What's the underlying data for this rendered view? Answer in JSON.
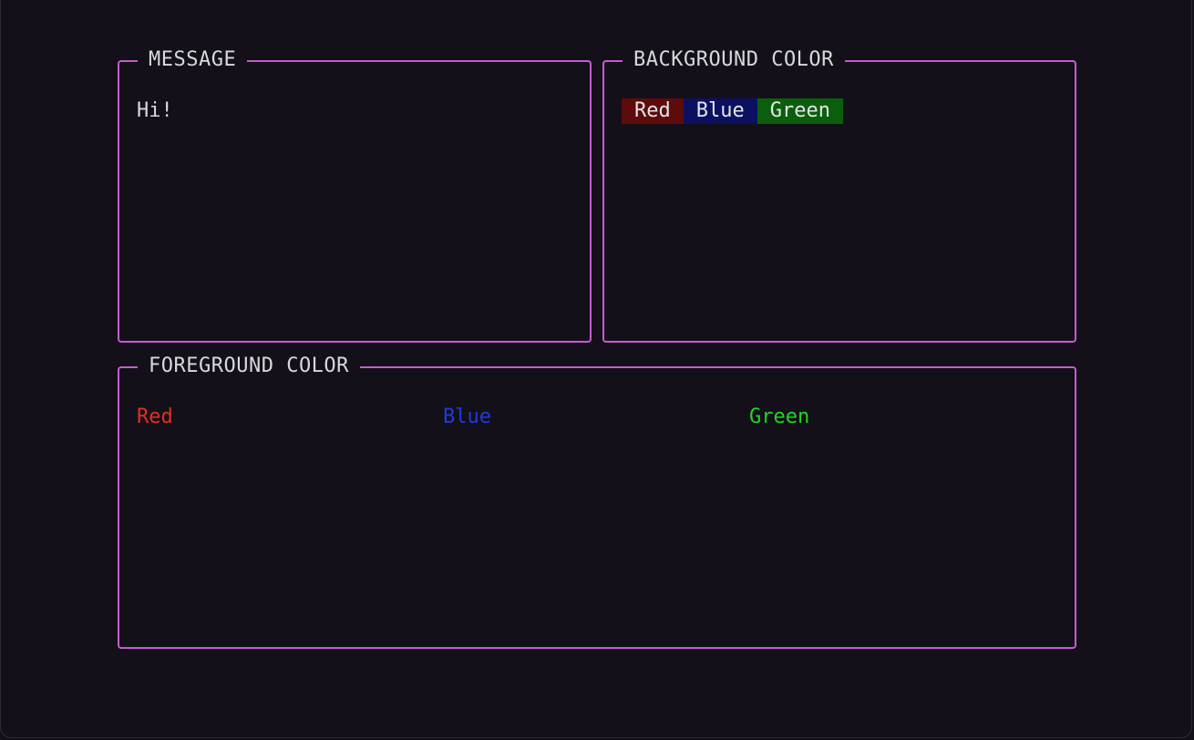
{
  "message_panel": {
    "title": "MESSAGE",
    "text": "Hi!"
  },
  "background_panel": {
    "title": "BACKGROUND COLOR",
    "options": [
      {
        "label": "Red",
        "color": "#5e0b0b"
      },
      {
        "label": "Blue",
        "color": "#0b1160"
      },
      {
        "label": "Green",
        "color": "#0b5e0b"
      }
    ]
  },
  "foreground_panel": {
    "title": "FOREGROUND COLOR",
    "options": [
      {
        "label": "Red",
        "color": "#e0301e"
      },
      {
        "label": "Blue",
        "color": "#1f3adf"
      },
      {
        "label": "Green",
        "color": "#1fd61f"
      }
    ]
  },
  "theme": {
    "border_color": "#c75ad3",
    "background": "#131019",
    "text_color": "#d8d8dc"
  }
}
